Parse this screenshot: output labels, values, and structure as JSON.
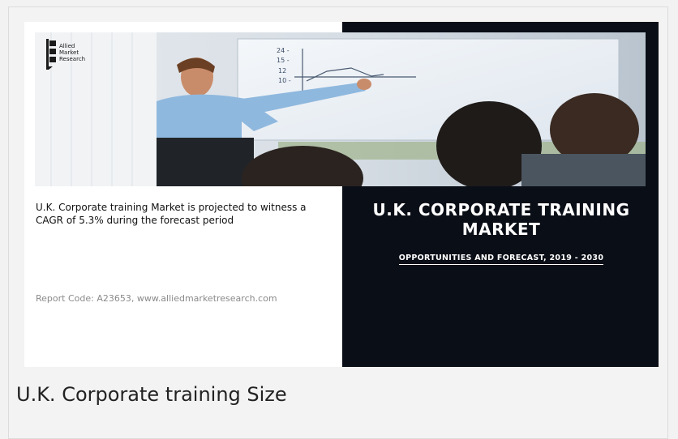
{
  "logo": {
    "lines": [
      "Allied",
      "Market",
      "Research"
    ]
  },
  "card": {
    "description": "U.K. Corporate training Market is projected to witness a CAGR of 5.3% during the forecast period",
    "report_code": "Report Code: A23653, www.alliedmarketresearch.com"
  },
  "panel": {
    "title": "U.K. CORPORATE TRAINING MARKET",
    "subtitle": "OPPORTUNITIES AND FORECAST, 2019 - 2030"
  },
  "caption": "U.K. Corporate training Size",
  "colors": {
    "panel_bg": "#0a0e17",
    "page_bg": "#f2f2f2"
  }
}
